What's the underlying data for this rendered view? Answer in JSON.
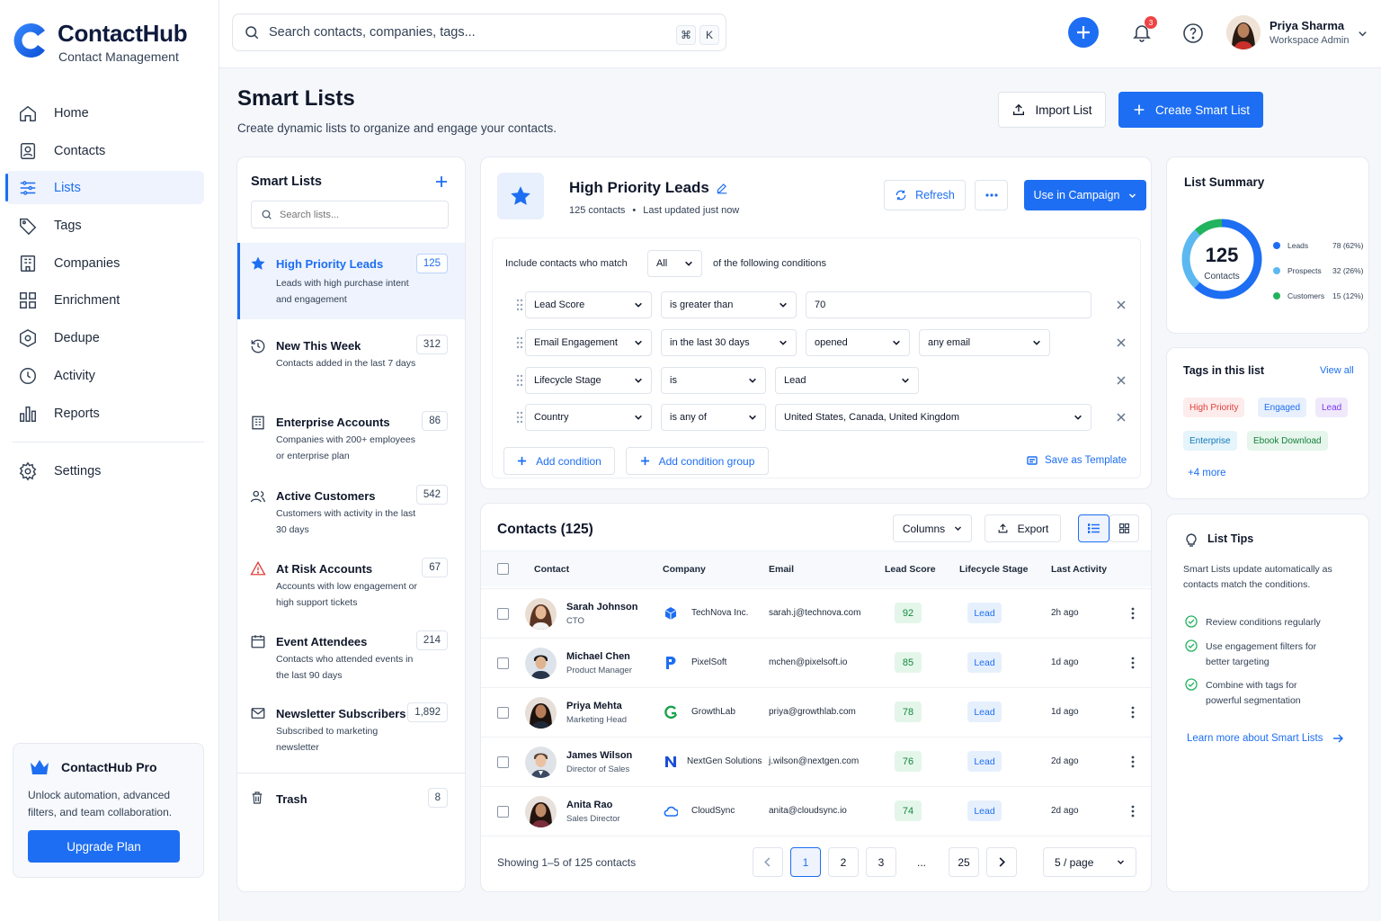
{
  "app": {
    "name": "ContactHub",
    "subtitle": "Contact Management"
  },
  "nav": [
    {
      "label": "Home",
      "icon": "home-icon"
    },
    {
      "label": "Contacts",
      "icon": "contacts-icon"
    },
    {
      "label": "Lists",
      "icon": "lists-icon",
      "active": true
    },
    {
      "label": "Tags",
      "icon": "tag-icon"
    },
    {
      "label": "Companies",
      "icon": "building-icon"
    },
    {
      "label": "Enrichment",
      "icon": "enrichment-icon"
    },
    {
      "label": "Dedupe",
      "icon": "dedupe-icon"
    },
    {
      "label": "Activity",
      "icon": "clock-icon"
    },
    {
      "label": "Reports",
      "icon": "bar-chart-icon"
    }
  ],
  "settings_label": "Settings",
  "pro": {
    "title": "ContactHub Pro",
    "text": "Unlock automation, advanced filters, and team collaboration.",
    "button": "Upgrade Plan"
  },
  "topbar": {
    "search_placeholder": "Search contacts, companies, tags...",
    "kbd1": "⌘",
    "kbd2": "K",
    "notif_count": "3",
    "user_name": "Priya Sharma",
    "user_role": "Workspace Admin"
  },
  "page": {
    "title": "Smart Lists",
    "subtitle": "Create dynamic lists to organize and engage your contacts.",
    "import_label": "Import List",
    "create_label": "Create Smart List"
  },
  "lists_panel": {
    "title": "Smart Lists",
    "search_placeholder": "Search lists...",
    "items": [
      {
        "name": "High Priority Leads",
        "desc": "Leads with high purchase intent and engagement",
        "count": "125",
        "icon": "star-icon"
      },
      {
        "name": "New This Week",
        "desc": "Contacts added in the last 7 days",
        "count": "312",
        "icon": "history-icon"
      },
      {
        "name": "Enterprise Accounts",
        "desc": "Companies with 200+ employees or enterprise plan",
        "count": "86",
        "icon": "building-icon"
      },
      {
        "name": "Active Customers",
        "desc": "Customers with activity in the last 30 days",
        "count": "542",
        "icon": "users-icon"
      },
      {
        "name": "At Risk Accounts",
        "desc": "Accounts with low engagement or high support tickets",
        "count": "67",
        "icon": "warning-icon"
      },
      {
        "name": "Event Attendees",
        "desc": "Contacts who attended events in the last 90 days",
        "count": "214",
        "icon": "calendar-icon"
      },
      {
        "name": "Newsletter Subscribers",
        "desc": "Subscribed to marketing newsletter",
        "count": "1,892",
        "icon": "mail-icon"
      }
    ],
    "trash": {
      "name": "Trash",
      "count": "8"
    }
  },
  "list_detail": {
    "title": "High Priority Leads",
    "contacts": "125 contacts",
    "updated": "Last updated just now",
    "refresh": "Refresh",
    "campaign": "Use in Campaign",
    "match_prefix": "Include contacts who match",
    "match_value": "All",
    "match_suffix": "of the following conditions",
    "conditions": [
      {
        "field": "Lead Score",
        "op": "is greater than",
        "value": "70"
      },
      {
        "field": "Email Engagement",
        "op": "in the last 30 days",
        "value": "opened",
        "value2": "any email"
      },
      {
        "field": "Lifecycle Stage",
        "op": "is",
        "value": "Lead"
      },
      {
        "field": "Country",
        "op": "is any of",
        "value": "United States, Canada, United Kingdom"
      }
    ],
    "add_condition": "Add condition",
    "add_group": "Add condition group",
    "save_template": "Save as Template"
  },
  "contacts_table": {
    "title": "Contacts (125)",
    "columns_btn": "Columns",
    "export_btn": "Export",
    "headers": [
      "Contact",
      "Company",
      "Email",
      "Lead Score",
      "Lifecycle Stage",
      "Last Activity"
    ],
    "rows": [
      {
        "name": "Sarah Johnson",
        "role": "CTO",
        "company": "TechNova Inc.",
        "email": "sarah.j@technova.com",
        "score": "92",
        "stage": "Lead",
        "activity": "2h ago",
        "logo_color": "#1d6ef2"
      },
      {
        "name": "Michael Chen",
        "role": "Product Manager",
        "company": "PixelSoft",
        "email": "mchen@pixelsoft.io",
        "score": "85",
        "stage": "Lead",
        "activity": "1d ago",
        "logo_color": "#1d6ef2"
      },
      {
        "name": "Priya Mehta",
        "role": "Marketing Head",
        "company": "GrowthLab",
        "email": "priya@growthlab.com",
        "score": "78",
        "stage": "Lead",
        "activity": "1d ago",
        "logo_color": "#16a34a"
      },
      {
        "name": "James Wilson",
        "role": "Director of Sales",
        "company": "NextGen Solutions",
        "email": "j.wilson@nextgen.com",
        "score": "76",
        "stage": "Lead",
        "activity": "2d ago",
        "logo_color": "#1d4ed8"
      },
      {
        "name": "Anita Rao",
        "role": "Sales Director",
        "company": "CloudSync",
        "email": "anita@cloudsync.io",
        "score": "74",
        "stage": "Lead",
        "activity": "2d ago",
        "logo_color": "#1d6ef2"
      }
    ],
    "showing": "Showing 1–5 of 125 contacts",
    "pages": [
      "1",
      "2",
      "3",
      "...",
      "25"
    ],
    "per_page": "5 / page"
  },
  "summary": {
    "title": "List Summary",
    "total": "125",
    "total_label": "Contacts",
    "segments": [
      {
        "label": "Leads",
        "value": "78 (62%)",
        "fraction": 0.62,
        "color": "#1d6ef2"
      },
      {
        "label": "Prospects",
        "value": "32 (26%)",
        "fraction": 0.26,
        "color": "#5cb8f0"
      },
      {
        "label": "Customers",
        "value": "15 (12%)",
        "fraction": 0.12,
        "color": "#22b35e"
      }
    ]
  },
  "tags_panel": {
    "title": "Tags in this list",
    "view_all": "View all",
    "tags": [
      {
        "label": "High Priority",
        "bg": "#fdecec",
        "fg": "#e0403b"
      },
      {
        "label": "Engaged",
        "bg": "#e8f0fd",
        "fg": "#1d6ef2"
      },
      {
        "label": "Lead",
        "bg": "#efe9fb",
        "fg": "#7c3aed"
      },
      {
        "label": "Enterprise",
        "bg": "#e6f4fb",
        "fg": "#0c7ab8"
      },
      {
        "label": "Ebook Download",
        "bg": "#e6f6ec",
        "fg": "#15803d"
      }
    ],
    "more": "+4 more"
  },
  "tips": {
    "title": "List Tips",
    "intro": "Smart Lists update automatically as contacts match the conditions.",
    "items": [
      "Review conditions regularly",
      "Use engagement filters for better targeting",
      "Combine with tags for powerful segmentation"
    ],
    "link": "Learn more about Smart Lists"
  }
}
